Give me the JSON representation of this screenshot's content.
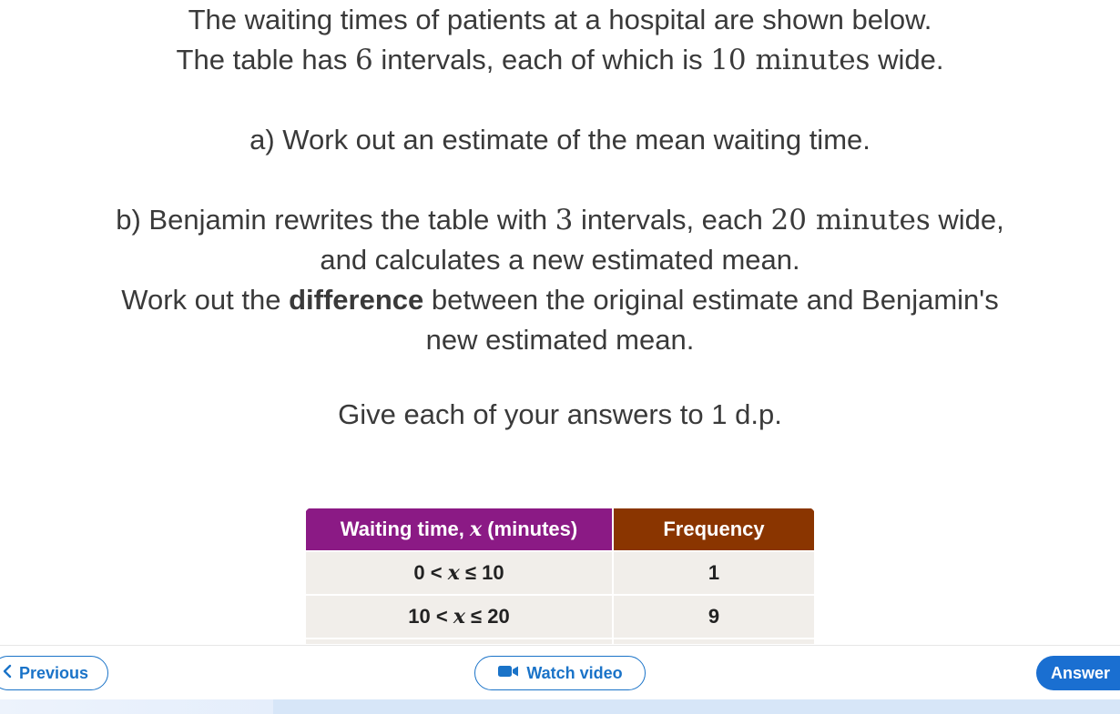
{
  "question": {
    "line1": "The waiting times of patients at a hospital are shown below.",
    "line2_a": "The table has ",
    "line2_num1": "6",
    "line2_b": " intervals, each of which is ",
    "line2_num2": "10",
    "line2_unit": " minutes",
    "line2_c": " wide.",
    "part_a": "a) Work out an estimate of the mean waiting time.",
    "part_b1_a": "b) Benjamin rewrites the table with ",
    "part_b1_num1": "3",
    "part_b1_b": " intervals, each ",
    "part_b1_num2": "20",
    "part_b1_unit": " minutes",
    "part_b1_c": " wide,",
    "part_b2": "and calculates a new estimated mean.",
    "part_b3_a": "Work out the ",
    "part_b3_bold": "difference",
    "part_b3_b": " between the original estimate and Benjamin's",
    "part_b4": "new estimated mean.",
    "instruction": "Give each of your answers to 1 d.p."
  },
  "table": {
    "header_time_a": "Waiting time, ",
    "header_time_var": "x",
    "header_time_b": " (minutes)",
    "header_freq": "Frequency",
    "rows": [
      {
        "lo": "0",
        "op1": " < ",
        "var": "x",
        "op2": " ≤ ",
        "hi": "10",
        "freq": "1"
      },
      {
        "lo": "10",
        "op1": " < ",
        "var": "x",
        "op2": " ≤ ",
        "hi": "20",
        "freq": "9"
      }
    ]
  },
  "nav": {
    "previous": "Previous",
    "previous_icon": "chevron-left-icon",
    "watch_video": "Watch video",
    "video_icon": "video-camera-icon",
    "answer": "Answer"
  }
}
